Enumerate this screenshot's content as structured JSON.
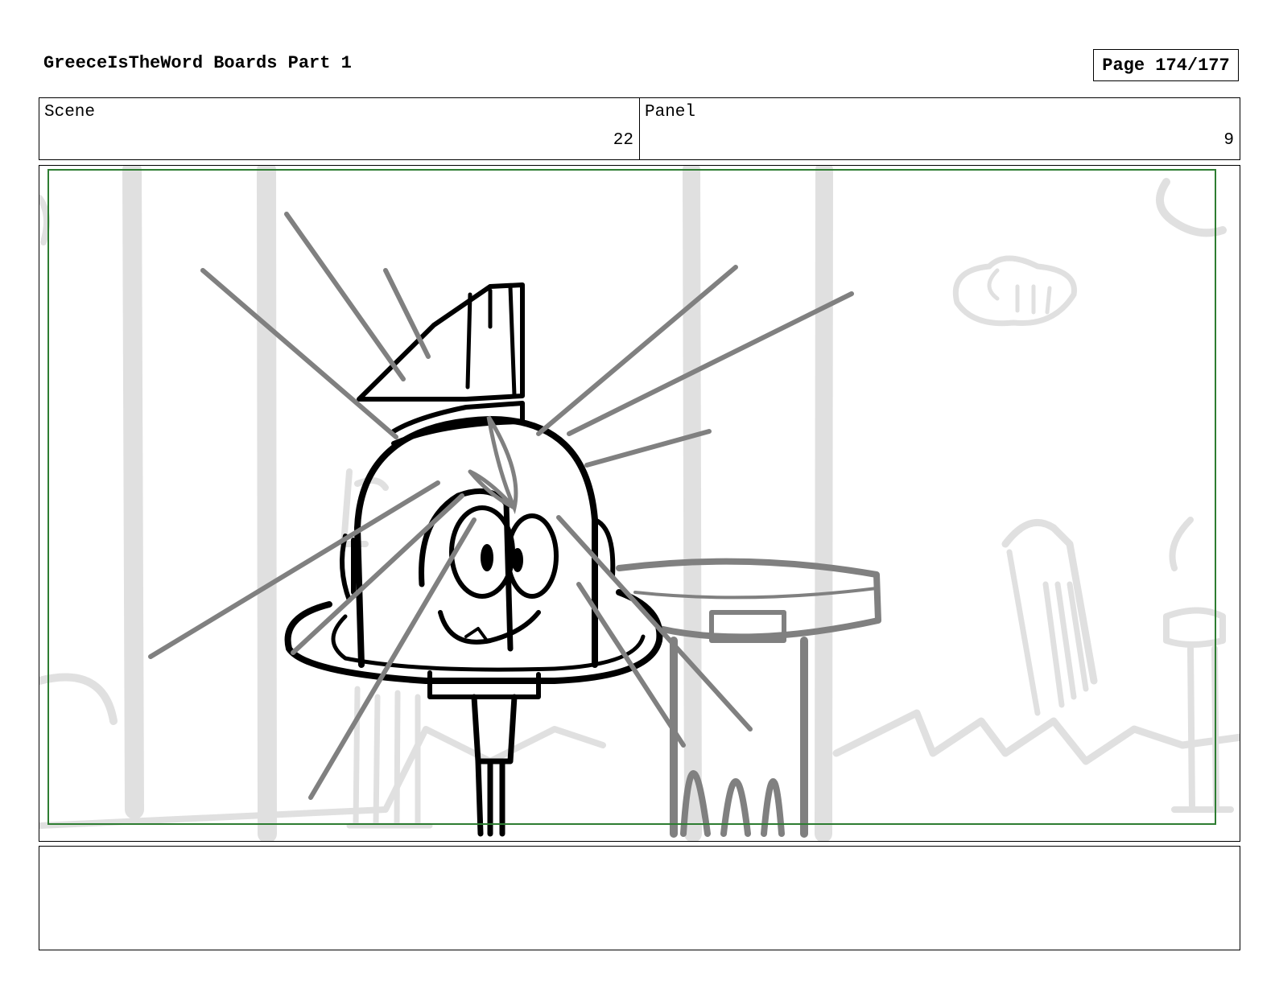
{
  "header": {
    "title": "GreeceIsTheWord Boards Part 1",
    "page": "Page 174/177"
  },
  "meta": {
    "scene_label": "Scene",
    "scene_value": "22",
    "panel_label": "Panel",
    "panel_value": "9"
  },
  "drawing": {
    "safe_area_color": "#2e7d32",
    "background_line_color": "#e0e0e0",
    "ray_color": "#808080",
    "ink_color": "#000000"
  },
  "notes": {
    "text": ""
  }
}
